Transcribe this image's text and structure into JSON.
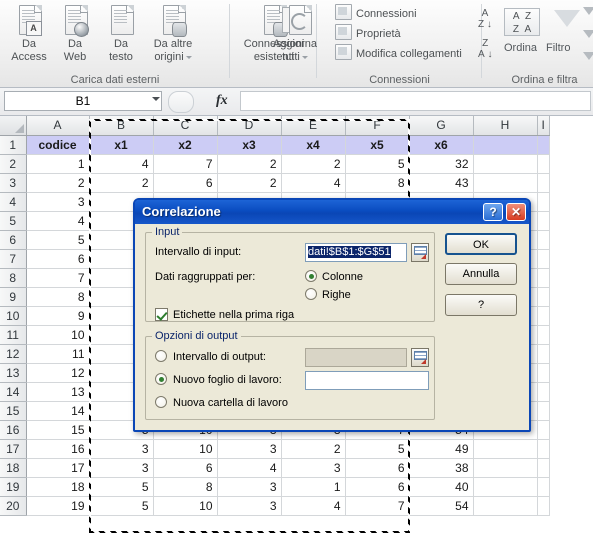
{
  "ribbon": {
    "groups": [
      {
        "name": "Carica dati esterni",
        "label": "Carica dati esterni",
        "buttons": [
          {
            "line1": "Da",
            "line2": "Access",
            "icon": "document-access-icon",
            "caret": false
          },
          {
            "line1": "Da",
            "line2": "Web",
            "icon": "document-web-icon",
            "caret": false
          },
          {
            "line1": "Da",
            "line2": "testo",
            "icon": "document-text-icon",
            "caret": false
          },
          {
            "line1": "Da altre",
            "line2": "origini",
            "icon": "document-other-sources-icon",
            "caret": true
          }
        ]
      },
      {
        "name": "connessioni-esistenti",
        "label": "",
        "buttons": [
          {
            "line1": "Connessioni",
            "line2": "esistenti",
            "icon": "existing-connections-icon",
            "caret": false
          }
        ]
      },
      {
        "name": "Connessioni",
        "label": "Connessioni",
        "buttons": [
          {
            "line1": "Aggiorna",
            "line2": "tutti",
            "icon": "refresh-all-icon",
            "caret": true
          }
        ],
        "small_items": [
          {
            "label": "Connessioni",
            "icon": "connections-icon"
          },
          {
            "label": "Proprietà",
            "icon": "properties-icon"
          },
          {
            "label": "Modifica collegamenti",
            "icon": "edit-links-icon"
          }
        ]
      },
      {
        "name": "Ordina e filtra",
        "label": "Ordina e filtra",
        "sort_asc": "A\nZ",
        "sort_desc": "Z\nA",
        "sort_label": "Ordina",
        "filter_label": "Filtro"
      }
    ]
  },
  "formula_bar": {
    "name_box": "B1",
    "fx_label": "fx",
    "formula_value": "",
    "formula_placeholder": ""
  },
  "sheet": {
    "columns": [
      "A",
      "B",
      "C",
      "D",
      "E",
      "F",
      "G",
      "H",
      "I"
    ],
    "header_row_index": 1,
    "headers": [
      "codice",
      "x1",
      "x2",
      "x3",
      "x4",
      "x5",
      "x6",
      "",
      ""
    ],
    "rows": [
      {
        "n": "1",
        "cells": [
          "codice",
          "x1",
          "x2",
          "x3",
          "x4",
          "x5",
          "x6",
          "",
          ""
        ]
      },
      {
        "n": "2",
        "cells": [
          "1",
          "4",
          "7",
          "2",
          "2",
          "5",
          "32",
          "",
          ""
        ]
      },
      {
        "n": "3",
        "cells": [
          "2",
          "2",
          "6",
          "2",
          "4",
          "8",
          "43",
          "",
          ""
        ]
      },
      {
        "n": "4",
        "cells": [
          "3",
          "",
          "",
          "",
          "",
          "",
          "",
          "",
          ""
        ]
      },
      {
        "n": "5",
        "cells": [
          "4",
          "",
          "",
          "",
          "",
          "",
          "",
          "",
          ""
        ]
      },
      {
        "n": "6",
        "cells": [
          "5",
          "",
          "",
          "",
          "",
          "",
          "",
          "",
          ""
        ]
      },
      {
        "n": "7",
        "cells": [
          "6",
          "",
          "",
          "",
          "",
          "",
          "",
          "",
          ""
        ]
      },
      {
        "n": "8",
        "cells": [
          "7",
          "",
          "",
          "",
          "",
          "",
          "",
          "",
          ""
        ]
      },
      {
        "n": "9",
        "cells": [
          "8",
          "",
          "",
          "",
          "",
          "",
          "",
          "",
          ""
        ]
      },
      {
        "n": "10",
        "cells": [
          "9",
          "",
          "",
          "",
          "",
          "",
          "",
          "",
          ""
        ]
      },
      {
        "n": "11",
        "cells": [
          "10",
          "",
          "",
          "",
          "",
          "",
          "",
          "",
          ""
        ]
      },
      {
        "n": "12",
        "cells": [
          "11",
          "",
          "",
          "",
          "",
          "",
          "",
          "",
          ""
        ]
      },
      {
        "n": "13",
        "cells": [
          "12",
          "",
          "",
          "",
          "",
          "",
          "",
          "",
          ""
        ]
      },
      {
        "n": "14",
        "cells": [
          "13",
          "",
          "",
          "",
          "",
          "",
          "",
          "",
          ""
        ]
      },
      {
        "n": "15",
        "cells": [
          "14",
          "",
          "",
          "",
          "",
          "",
          "",
          "",
          ""
        ]
      },
      {
        "n": "16",
        "cells": [
          "15",
          "5",
          "10",
          "3",
          "3",
          "7",
          "54",
          "",
          ""
        ]
      },
      {
        "n": "17",
        "cells": [
          "16",
          "3",
          "10",
          "3",
          "2",
          "5",
          "49",
          "",
          ""
        ]
      },
      {
        "n": "18",
        "cells": [
          "17",
          "3",
          "6",
          "4",
          "3",
          "6",
          "38",
          "",
          ""
        ]
      },
      {
        "n": "19",
        "cells": [
          "18",
          "5",
          "8",
          "3",
          "1",
          "6",
          "40",
          "",
          ""
        ]
      },
      {
        "n": "20",
        "cells": [
          "19",
          "5",
          "10",
          "3",
          "4",
          "7",
          "54",
          "",
          ""
        ]
      }
    ]
  },
  "dialog": {
    "title": "Correlazione",
    "help_button": "?",
    "close_button": "✕",
    "input_group": {
      "legend": "Input",
      "range_label": "Intervallo di input:",
      "range_value": "dati!$B$1:$G$51",
      "grouped_label": "Dati raggruppati per:",
      "radio_columns": "Colonne",
      "radio_rows": "Righe",
      "radio_selected": "Colonne",
      "labels_checkbox": "Etichette nella prima riga",
      "labels_checked": true,
      "picker_icon": "range-picker-icon"
    },
    "output_group": {
      "legend": "Opzioni di output",
      "radio_output_range": "Intervallo di output:",
      "output_range_value": "",
      "radio_new_sheet": "Nuovo foglio di lavoro:",
      "new_sheet_value": "",
      "radio_new_workbook": "Nuova cartella di lavoro",
      "selected": "Nuovo foglio di lavoro:",
      "picker_icon": "range-picker-icon"
    },
    "buttons": {
      "ok": "OK",
      "cancel": "Annulla",
      "help": "?"
    }
  }
}
